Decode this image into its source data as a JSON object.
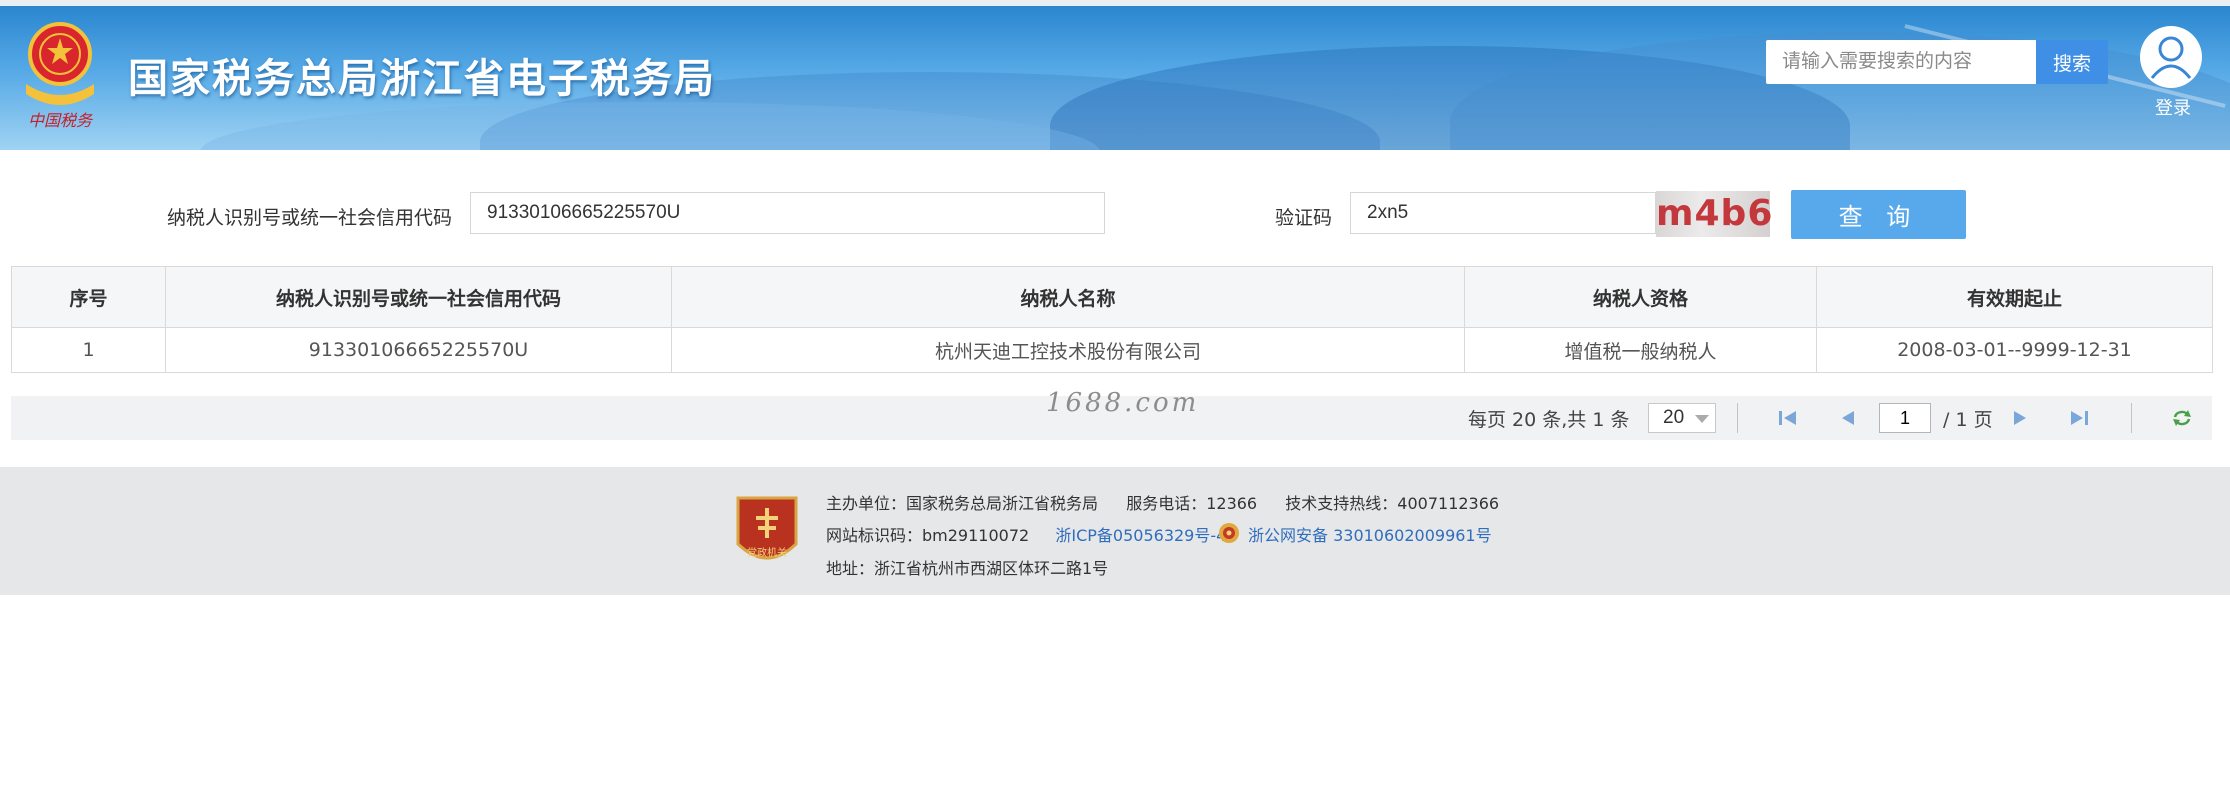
{
  "header": {
    "site_title": "国家税务总局浙江省电子税务局",
    "emblem_caption": "中国税务",
    "search_placeholder": "请输入需要搜索的内容",
    "search_button": "搜索",
    "login_label": "登录"
  },
  "query": {
    "taxpayer_id_label": "纳税人识别号或统一社会信用代码",
    "taxpayer_id_value": "91330106665225570U",
    "captcha_label": "验证码",
    "captcha_value": "2xn5",
    "captcha_image_text": "m4b6",
    "query_button": "查 询"
  },
  "table": {
    "columns": [
      "序号",
      "纳税人识别号或统一社会信用代码",
      "纳税人名称",
      "纳税人资格",
      "有效期起止"
    ],
    "rows": [
      [
        "1",
        "91330106665225570U",
        "杭州天迪工控技术股份有限公司",
        "增值税一般纳税人",
        "2008-03-01--9999-12-31"
      ]
    ]
  },
  "pager": {
    "watermark": "1688.com",
    "summary": "每页 20 条,共 1 条",
    "page_size": "20",
    "current_page": "1",
    "total_pages_label": "/ 1 页"
  },
  "footer": {
    "organizer": "主办单位：国家税务总局浙江省税务局",
    "service_phone": "服务电话：12366",
    "support_hotline": "技术支持热线：4007112366",
    "site_code": "网站标识码：bm29110072",
    "icp_link": "浙ICP备05056329号-4",
    "police_link": "浙公网安备 33010602009961号",
    "address": "地址：浙江省杭州市西湖区体环二路1号",
    "badge_text": "党政机关"
  },
  "colors": {
    "header_top": "#2a86cf",
    "primary_button": "#58a8ec",
    "search_button": "#3f8fe6",
    "link": "#2f6dbd",
    "captcha_text": "#c3383d"
  }
}
